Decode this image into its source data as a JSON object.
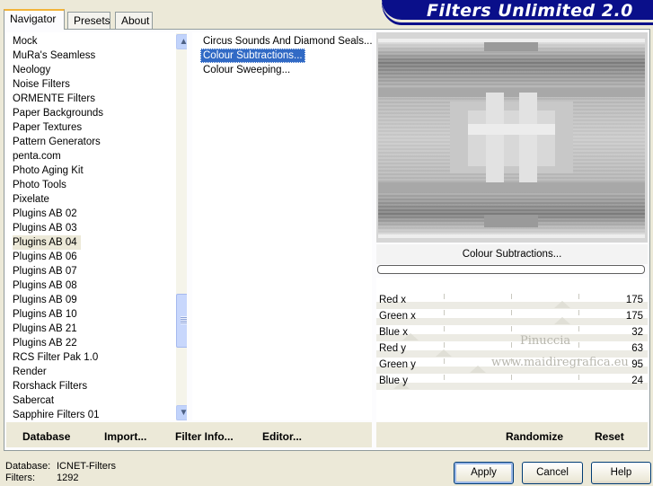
{
  "tabs": [
    {
      "label": "Navigator",
      "active": true
    },
    {
      "label": "Presets",
      "active": false
    },
    {
      "label": "About",
      "active": false
    }
  ],
  "app_title": "Filters Unlimited 2.0",
  "categories": [
    "Mock",
    "MuRa's Seamless",
    "Neology",
    "Noise Filters",
    "ORMENTE Filters",
    "Paper Backgrounds",
    "Paper Textures",
    "Pattern Generators",
    "penta.com",
    "Photo Aging Kit",
    "Photo Tools",
    "Pixelate",
    "Plugins AB 02",
    "Plugins AB 03",
    "Plugins AB 04",
    "Plugins AB 06",
    "Plugins AB 07",
    "Plugins AB 08",
    "Plugins AB 09",
    "Plugins AB 10",
    "Plugins AB 21",
    "Plugins AB 22",
    "RCS Filter Pak 1.0",
    "Render",
    "Rorshack Filters",
    "Sabercat",
    "Sapphire Filters 01"
  ],
  "selected_category": "Plugins AB 04",
  "filters": [
    "Circus Sounds And Diamond Seals...",
    "Colour Subtractions...",
    "Colour Sweeping..."
  ],
  "selected_filter": "Colour Subtractions...",
  "filter_name": "Colour Subtractions...",
  "params": [
    {
      "label": "Red x",
      "value": "175",
      "level": 0.686
    },
    {
      "label": "Green x",
      "value": "175",
      "level": 0.686
    },
    {
      "label": "Blue x",
      "value": "32",
      "level": 0.125
    },
    {
      "label": "Red y",
      "value": "63",
      "level": 0.247
    },
    {
      "label": "Green y",
      "value": "95",
      "level": 0.373
    },
    {
      "label": "Blue y",
      "value": "24",
      "level": 0.094
    }
  ],
  "watermark": {
    "line1": "Pinuccia",
    "line2": "www.maidiregrafica.eu"
  },
  "bottom_left": {
    "database": "Database",
    "import": "Import...",
    "filter_info": "Filter Info...",
    "editor": "Editor..."
  },
  "bottom_right": {
    "randomize": "Randomize",
    "reset": "Reset"
  },
  "status": {
    "db_label": "Database:",
    "db_value": "ICNET-Filters",
    "filters_label": "Filters:",
    "filters_value": "1292"
  },
  "buttons": {
    "apply": "Apply",
    "cancel": "Cancel",
    "help": "Help"
  },
  "colors": {
    "banner": "#0a0f8a",
    "selection": "#316ac5",
    "tab_highlight": "#f2b43a"
  }
}
